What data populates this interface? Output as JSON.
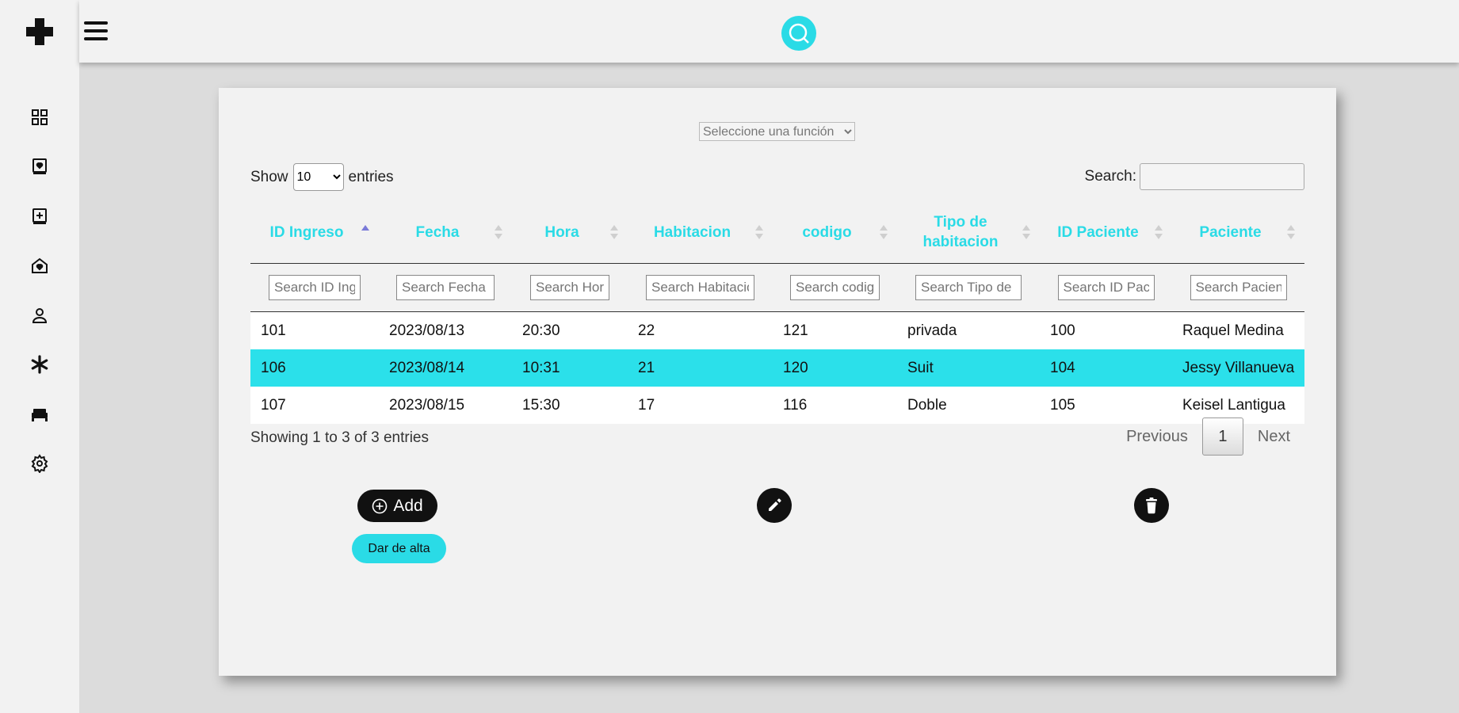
{
  "sidebar": {
    "icons": [
      "dashboard-icon",
      "patient-card-icon",
      "add-record-icon",
      "home-health-icon",
      "user-icon",
      "asterisk-icon",
      "bed-icon",
      "gear-icon"
    ]
  },
  "topbar": {
    "search_icon": "search-icon"
  },
  "function_select": {
    "selected": "Seleccione una función"
  },
  "length_control": {
    "show_label": "Show",
    "value": "10",
    "entries_label": "entries"
  },
  "search": {
    "label": "Search:",
    "value": ""
  },
  "table": {
    "columns": [
      {
        "label": "ID Ingreso",
        "filter_placeholder": "Search ID Ingreso"
      },
      {
        "label": "Fecha",
        "filter_placeholder": "Search Fecha"
      },
      {
        "label": "Hora",
        "filter_placeholder": "Search Hora"
      },
      {
        "label": "Habitacion",
        "filter_placeholder": "Search Habitacion"
      },
      {
        "label": "codigo",
        "filter_placeholder": "Search codigo"
      },
      {
        "label": "Tipo de habitacion",
        "filter_placeholder": "Search Tipo de habitacion"
      },
      {
        "label": "ID Paciente",
        "filter_placeholder": "Search ID Paciente"
      },
      {
        "label": "Paciente",
        "filter_placeholder": "Search Paciente"
      }
    ],
    "rows": [
      {
        "cells": [
          "101",
          "2023/08/13",
          "20:30",
          "22",
          "121",
          "privada",
          "100",
          "Raquel Medina"
        ]
      },
      {
        "cells": [
          "106",
          "2023/08/14",
          "10:31",
          "21",
          "120",
          "Suit",
          "104",
          "Jessy Villanueva"
        ]
      },
      {
        "cells": [
          "107",
          "2023/08/15",
          "15:30",
          "17",
          "116",
          "Doble",
          "105",
          "Keisel Lantigua"
        ]
      }
    ],
    "selected_row": 1
  },
  "info": "Showing 1 to 3 of 3 entries",
  "pagination": {
    "previous": "Previous",
    "current": "1",
    "next": "Next"
  },
  "actions": {
    "add_label": "Add",
    "alta_label": "Dar de alta"
  },
  "colors": {
    "accent": "#2adbe6",
    "dark": "#111111",
    "card": "#f2f2f2",
    "background": "#dcdcdc"
  }
}
